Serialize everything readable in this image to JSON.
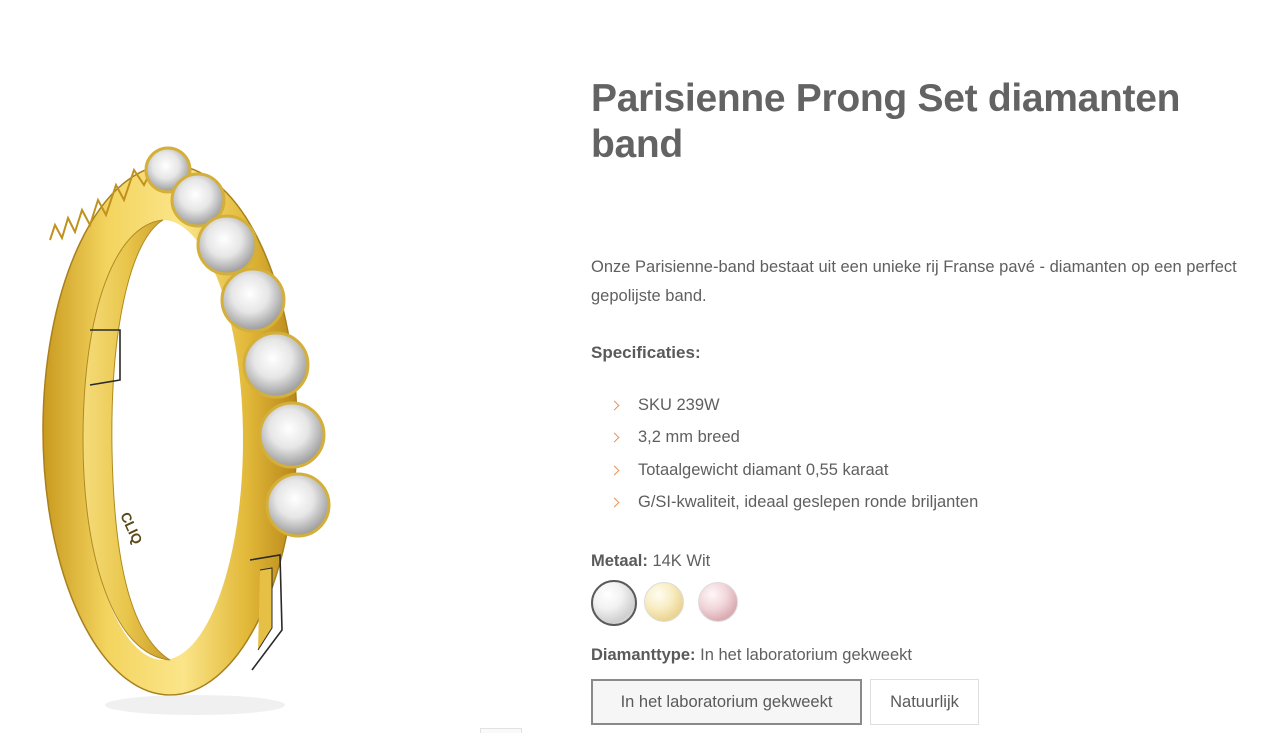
{
  "product": {
    "title": "Parisienne Prong Set diamanten band",
    "description": "Onze Parisienne-band bestaat uit een unieke rij Franse pavé - diamanten op een perfect gepolijste band.",
    "specs_heading": "Specificaties:",
    "specs": [
      "SKU 239W",
      "3,2 mm breed",
      "Totaalgewicht diamant 0,55 karaat",
      "G/SI-kwaliteit, ideaal geslepen ronde briljanten"
    ],
    "engraving": "CLIQ"
  },
  "metal": {
    "label": "Metaal:",
    "selected_value": "14K Wit",
    "options": [
      {
        "name": "white-gold",
        "color": "#e6e6e6",
        "selected": true
      },
      {
        "name": "yellow-gold",
        "color": "#f3e2a8",
        "selected": false
      },
      {
        "name": "rose-gold",
        "color": "#e8c3c8",
        "selected": false
      }
    ]
  },
  "diamond_type": {
    "label": "Diamanttype:",
    "selected_value": "In het laboratorium gekweekt",
    "options": [
      {
        "label": "In het laboratorium gekweekt",
        "selected": true
      },
      {
        "label": "Natuurlijk",
        "selected": false
      }
    ]
  },
  "colors": {
    "accent": "#e8935a",
    "text": "#5f5f5f",
    "title": "#636363",
    "gold": "#e8c34a"
  }
}
